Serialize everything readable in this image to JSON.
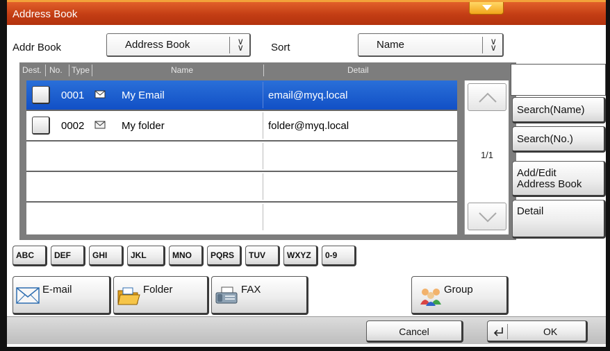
{
  "window": {
    "title": "Address Book"
  },
  "filters": {
    "addr_book_label": "Addr Book",
    "addr_book_value": "Address Book",
    "sort_label": "Sort",
    "sort_value": "Name"
  },
  "list": {
    "headers": {
      "dest": "Dest.",
      "no": "No.",
      "type": "Type",
      "name": "Name",
      "detail": "Detail"
    },
    "rows": [
      {
        "no": "0001",
        "type_icon": "envelope-icon",
        "name": "My Email",
        "detail": "email@myq.local",
        "selected": true
      },
      {
        "no": "0002",
        "type_icon": "envelope-icon",
        "name": "My folder",
        "detail": "folder@myq.local",
        "selected": false
      }
    ],
    "page_indicator": "1/1"
  },
  "side": {
    "search_name": "Search(Name)",
    "search_no": "Search(No.)",
    "add_edit_line1": "Add/Edit",
    "add_edit_line2": "Address Book",
    "detail": "Detail"
  },
  "alpha_keys": [
    "ABC",
    "DEF",
    "GHI",
    "JKL",
    "MNO",
    "PQRS",
    "TUV",
    "WXYZ",
    "0-9"
  ],
  "type_buttons": {
    "email": "E-mail",
    "folder": "Folder",
    "fax": "FAX",
    "group": "Group"
  },
  "footer": {
    "cancel": "Cancel",
    "ok": "OK"
  },
  "colors": {
    "title_bar": "#c8431a",
    "selection": "#1a5fd0",
    "panel_gray": "#7d7d7d"
  }
}
